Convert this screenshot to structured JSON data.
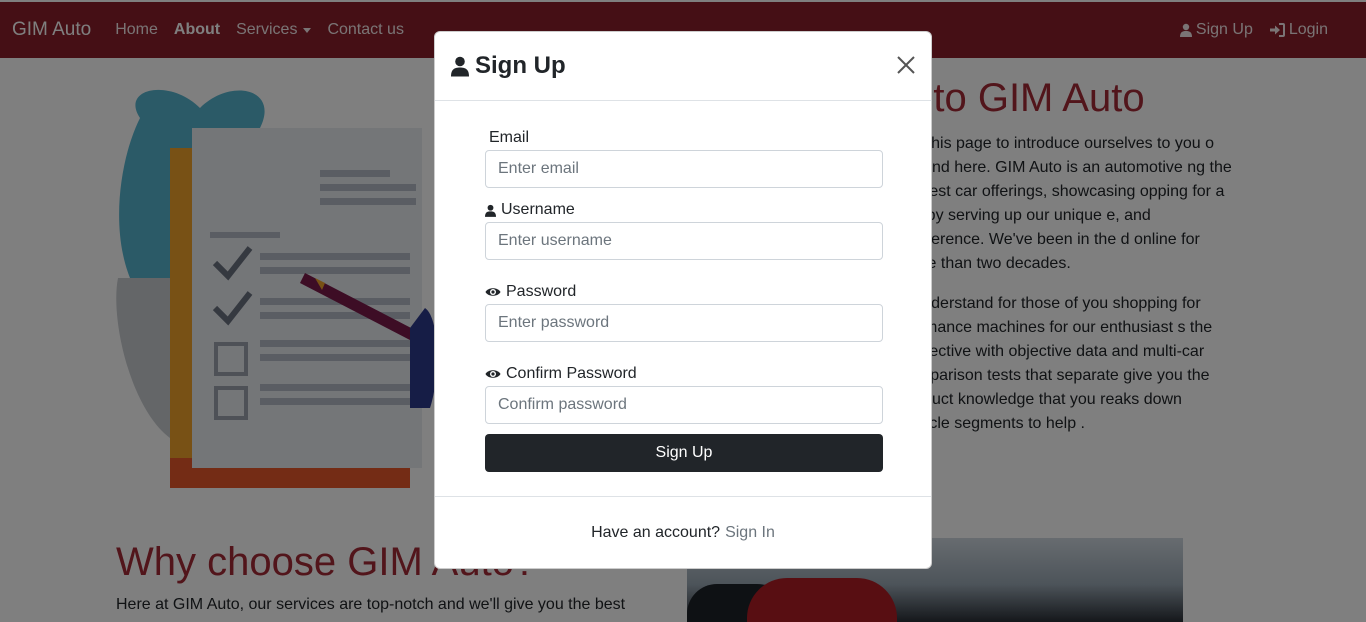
{
  "navbar": {
    "brand": "GIM Auto",
    "links": [
      {
        "label": "Home"
      },
      {
        "label": "About"
      },
      {
        "label": "Services"
      },
      {
        "label": "Contact us"
      }
    ],
    "signup_label": "Sign Up",
    "login_label": "Login"
  },
  "about": {
    "title": "n to GIM Auto",
    "paragraph1": "ted this page to introduce ourselves to you o around here. GIM Auto is an automotive ng the newest car offerings, showcasing opping for a car by serving up our unique e, and irreverence. We've been in the d online for more than two decades.",
    "paragraph2": "o understand for those of you shopping for rformance machines for our enthusiast s the subjective with objective data and multi-car comparison tests that separate give you the product knowledge that you reaks down vehicle segments to help ."
  },
  "why": {
    "title": "Why choose GIM Auto?",
    "text": "Here at GIM Auto, our services are top-notch and we'll give you the best"
  },
  "modal": {
    "title": "Sign Up",
    "email": {
      "label": "Email",
      "placeholder": "Enter email"
    },
    "username": {
      "label": "Username",
      "placeholder": "Enter username"
    },
    "password": {
      "label": "Password",
      "placeholder": "Enter password"
    },
    "confirm": {
      "label": "Confirm Password",
      "placeholder": "Confirm password"
    },
    "submit_label": "Sign Up",
    "footer_text": "Have an account?",
    "footer_link": "Sign In"
  },
  "colors": {
    "navbar": "#8a1f2a",
    "heading": "#a52a36",
    "button": "#212529"
  },
  "icons": [
    "user-icon",
    "sign-in-icon",
    "eye-icon",
    "close-icon",
    "caret-down-icon"
  ]
}
